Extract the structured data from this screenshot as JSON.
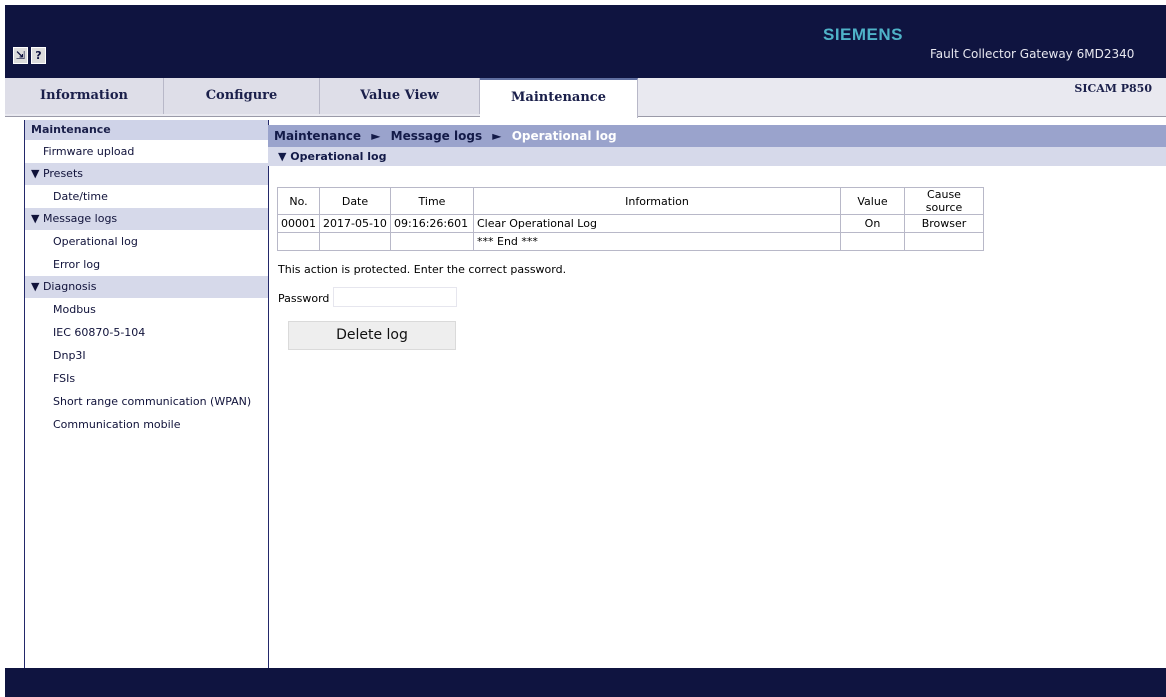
{
  "header": {
    "brand": "SIEMENS",
    "device_name": "Fault Collector Gateway 6MD2340",
    "model": "SICAM P850",
    "icons": [
      "exit-icon",
      "help-icon"
    ],
    "help_glyph": "?"
  },
  "tabs": [
    {
      "label": "Information"
    },
    {
      "label": "Configure"
    },
    {
      "label": "Value View"
    },
    {
      "label": "Maintenance",
      "active": true
    }
  ],
  "sidebar": {
    "title": "Maintenance",
    "firmware_upload": "Firmware upload",
    "presets": {
      "label": "▼ Presets",
      "items": [
        "Date/time"
      ]
    },
    "message_logs": {
      "label": "▼ Message logs",
      "items": [
        "Operational log",
        "Error log"
      ]
    },
    "diagnosis": {
      "label": "▼ Diagnosis",
      "items": [
        "Modbus",
        "IEC 60870-5-104",
        "Dnp3I",
        "FSIs",
        "Short range communication (WPAN)",
        "Communication mobile"
      ]
    }
  },
  "breadcrumb": {
    "items": [
      "Maintenance",
      "Message logs",
      "Operational log"
    ],
    "separator": "►"
  },
  "section_title": "▼ Operational log",
  "log_table": {
    "headers": [
      "No.",
      "Date",
      "Time",
      "Information",
      "Value",
      "Cause source"
    ],
    "rows": [
      [
        "00001",
        "2017-05-10",
        "09:16:26:601",
        "Clear Operational Log",
        "On",
        "Browser"
      ],
      [
        "",
        "",
        "",
        "*** End ***",
        "",
        ""
      ]
    ]
  },
  "protection_message": "This action is protected. Enter the correct password.",
  "password": {
    "label": "Password",
    "value": ""
  },
  "delete_button": "Delete log",
  "colors": {
    "navy": "#0f1440",
    "brand": "#4fb3c8",
    "breadcrumb_bg": "#9aa3cc",
    "section_bg": "#d6d9ea"
  }
}
